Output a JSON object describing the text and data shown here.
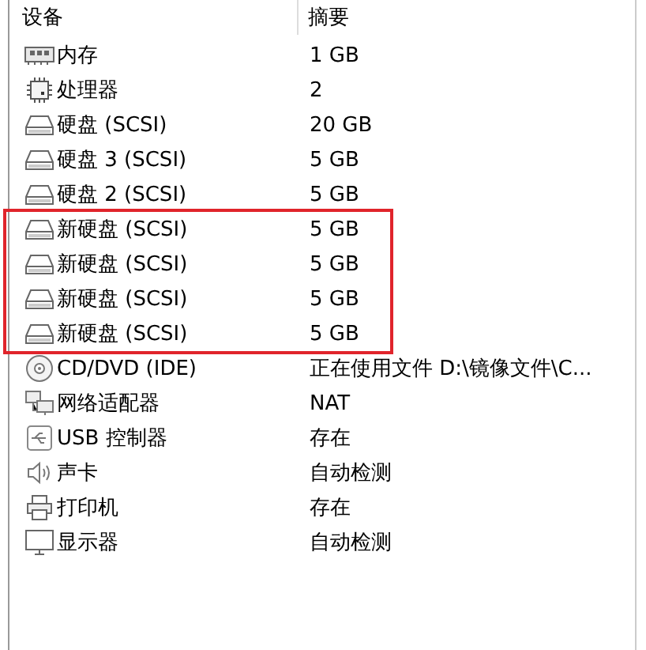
{
  "columns": [
    "设备",
    "摘要"
  ],
  "rows": [
    {
      "kind": "memory",
      "device": "内存",
      "summary": "1 GB",
      "highlighted": false
    },
    {
      "kind": "processor",
      "device": "处理器",
      "summary": "2",
      "highlighted": false
    },
    {
      "kind": "disk",
      "device": "硬盘 (SCSI)",
      "summary": "20 GB",
      "highlighted": false
    },
    {
      "kind": "disk",
      "device": "硬盘 3 (SCSI)",
      "summary": "5 GB",
      "highlighted": false
    },
    {
      "kind": "disk",
      "device": "硬盘 2 (SCSI)",
      "summary": "5 GB",
      "highlighted": false
    },
    {
      "kind": "disk",
      "device": "新硬盘 (SCSI)",
      "summary": "5 GB",
      "highlighted": true
    },
    {
      "kind": "disk",
      "device": "新硬盘 (SCSI)",
      "summary": "5 GB",
      "highlighted": true
    },
    {
      "kind": "disk",
      "device": "新硬盘 (SCSI)",
      "summary": "5 GB",
      "highlighted": true
    },
    {
      "kind": "disk",
      "device": "新硬盘 (SCSI)",
      "summary": "5 GB",
      "highlighted": true
    },
    {
      "kind": "cd",
      "device": "CD/DVD (IDE)",
      "summary": "正在使用文件 D:\\镜像文件\\C...",
      "highlighted": false
    },
    {
      "kind": "network",
      "device": "网络适配器",
      "summary": "NAT",
      "highlighted": false
    },
    {
      "kind": "usb",
      "device": "USB 控制器",
      "summary": "存在",
      "highlighted": false
    },
    {
      "kind": "sound",
      "device": "声卡",
      "summary": "自动检测",
      "highlighted": false
    },
    {
      "kind": "printer",
      "device": "打印机",
      "summary": "存在",
      "highlighted": false
    },
    {
      "kind": "display",
      "device": "显示器",
      "summary": "自动检测",
      "highlighted": false
    }
  ]
}
